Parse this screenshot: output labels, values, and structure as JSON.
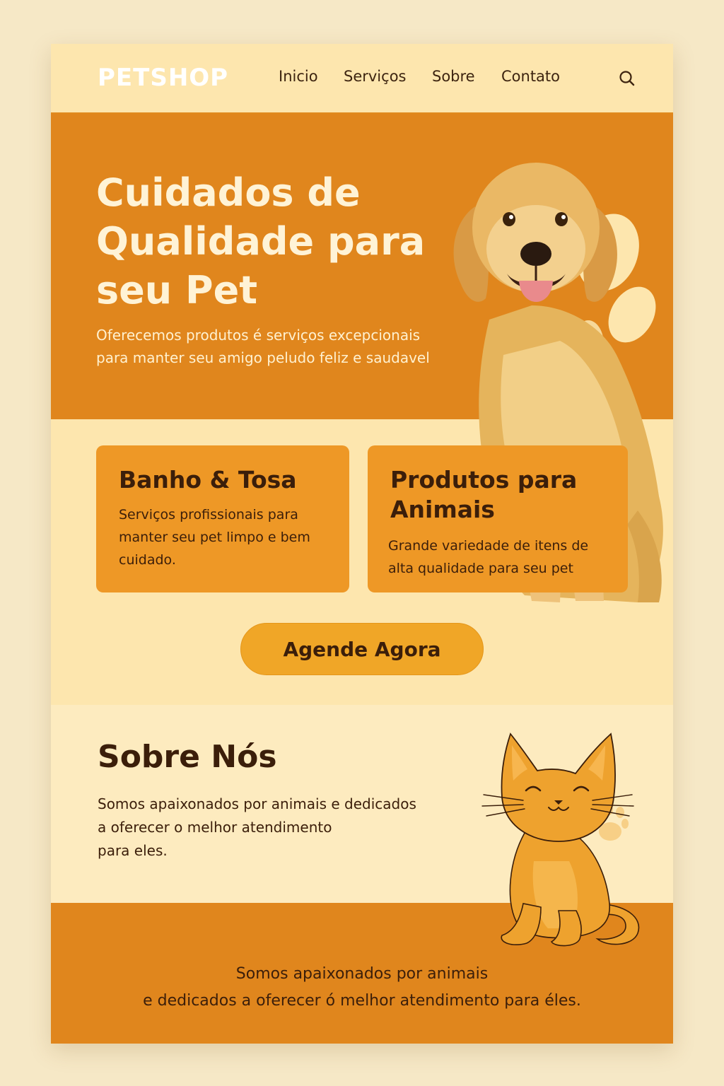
{
  "header": {
    "logo": "PETSHOP",
    "nav": [
      "Inicio",
      "Serviços",
      "Sobre",
      "Contato"
    ],
    "search_icon": "search-icon"
  },
  "hero": {
    "title": "Cuidados de Qualidade para seu Pet",
    "subtitle_line1": "Oferecemos produtos é serviços excepcionais",
    "subtitle_line2": "para manter seu amigo peludo feliz e saudavel"
  },
  "services": [
    {
      "title": "Banho & Tosa",
      "text_lines": [
        "Serviços profissionais para",
        "manter seu pet limpo  e bem",
        "cuidado."
      ]
    },
    {
      "title_lines": [
        "Produtos para",
        "Animais"
      ],
      "text_lines": [
        "Grande variedade de itens de",
        "alta qualidade para seu pet"
      ]
    }
  ],
  "cta": {
    "label": "Agende Agora"
  },
  "about": {
    "title": "Sobre Nós",
    "text_lines": [
      "Somos apaixonados por animais e dedicados",
      "a oferecer o melhor atendimento",
      "para eles."
    ]
  },
  "footer": {
    "line1": "Somos apaixonados por animais",
    "line2": "e dedicados a oferecer ó melhor atendimento para éles."
  },
  "colors": {
    "background": "#f6e8c6",
    "header": "#fde6ae",
    "orange": "#e0861d",
    "card": "#ee9826",
    "button": "#f0a627",
    "text_dark": "#3b1e0a",
    "text_light": "#fff3d6"
  },
  "images": {
    "hero": "golden-retriever-photo",
    "about": "cat-illustration"
  }
}
